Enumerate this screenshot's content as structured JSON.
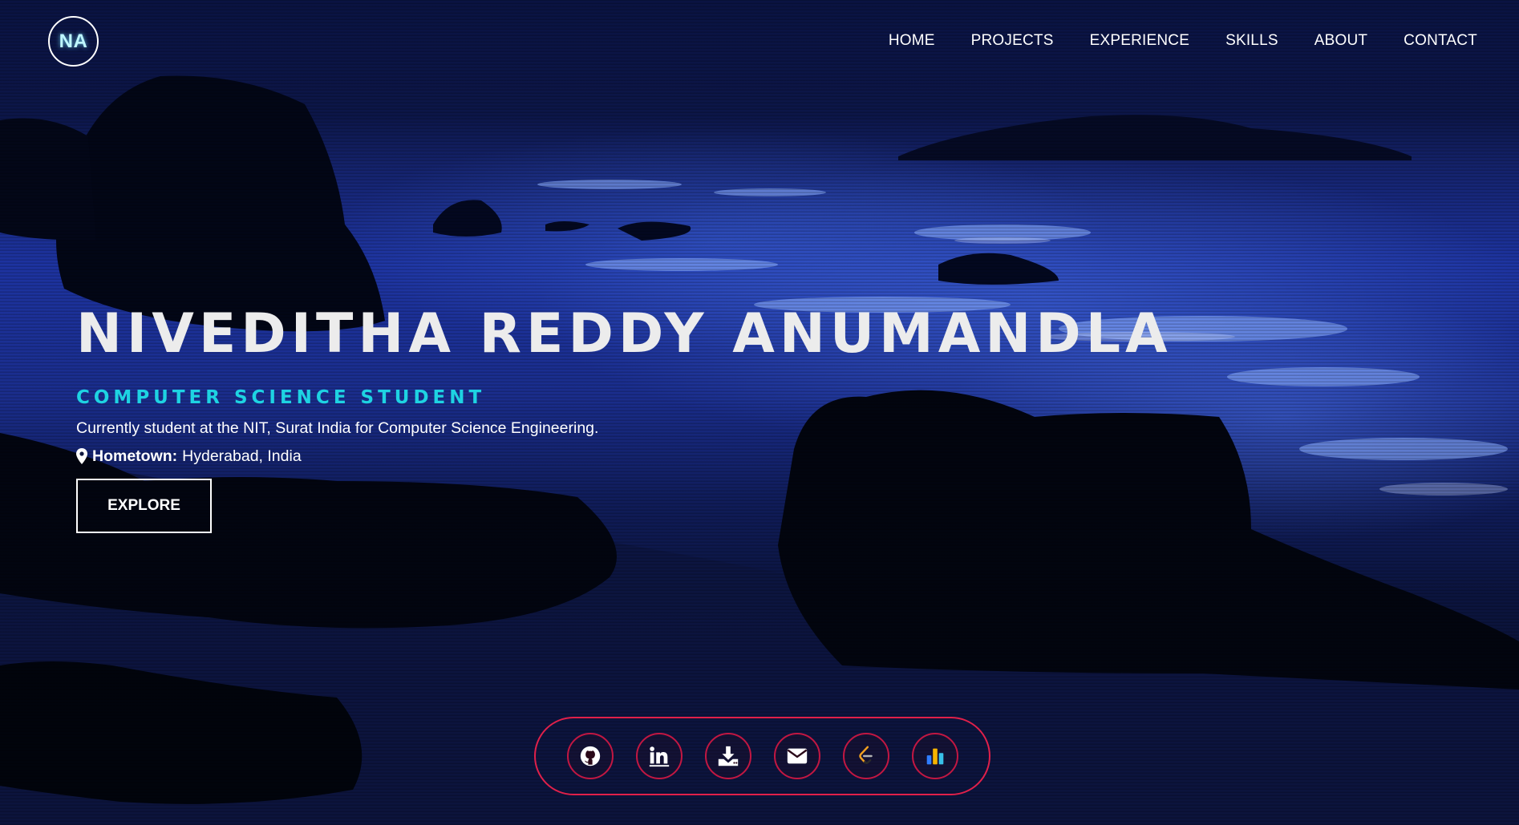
{
  "logo": {
    "initials": "NA"
  },
  "nav": {
    "items": [
      {
        "label": "HOME"
      },
      {
        "label": "PROJECTS"
      },
      {
        "label": "EXPERIENCE"
      },
      {
        "label": "SKILLS"
      },
      {
        "label": "ABOUT"
      },
      {
        "label": "CONTACT"
      }
    ]
  },
  "hero": {
    "name": "NIVEDITHA REDDY ANUMANDLA",
    "role": "COMPUTER SCIENCE STUDENT",
    "description": "Currently student at the NIT, Surat India for Computer Science Engineering.",
    "hometown_label": "Hometown:",
    "hometown_value": "Hyderabad, India",
    "cta_label": "EXPLORE"
  },
  "social": {
    "icons": [
      "github-icon",
      "linkedin-icon",
      "download-icon",
      "email-icon",
      "leetcode-icon",
      "codechef-stats-icon"
    ]
  },
  "colors": {
    "accent_cyan": "#1ed3e2",
    "social_border": "#e0204a",
    "logo_glow": "#bff7ff"
  }
}
